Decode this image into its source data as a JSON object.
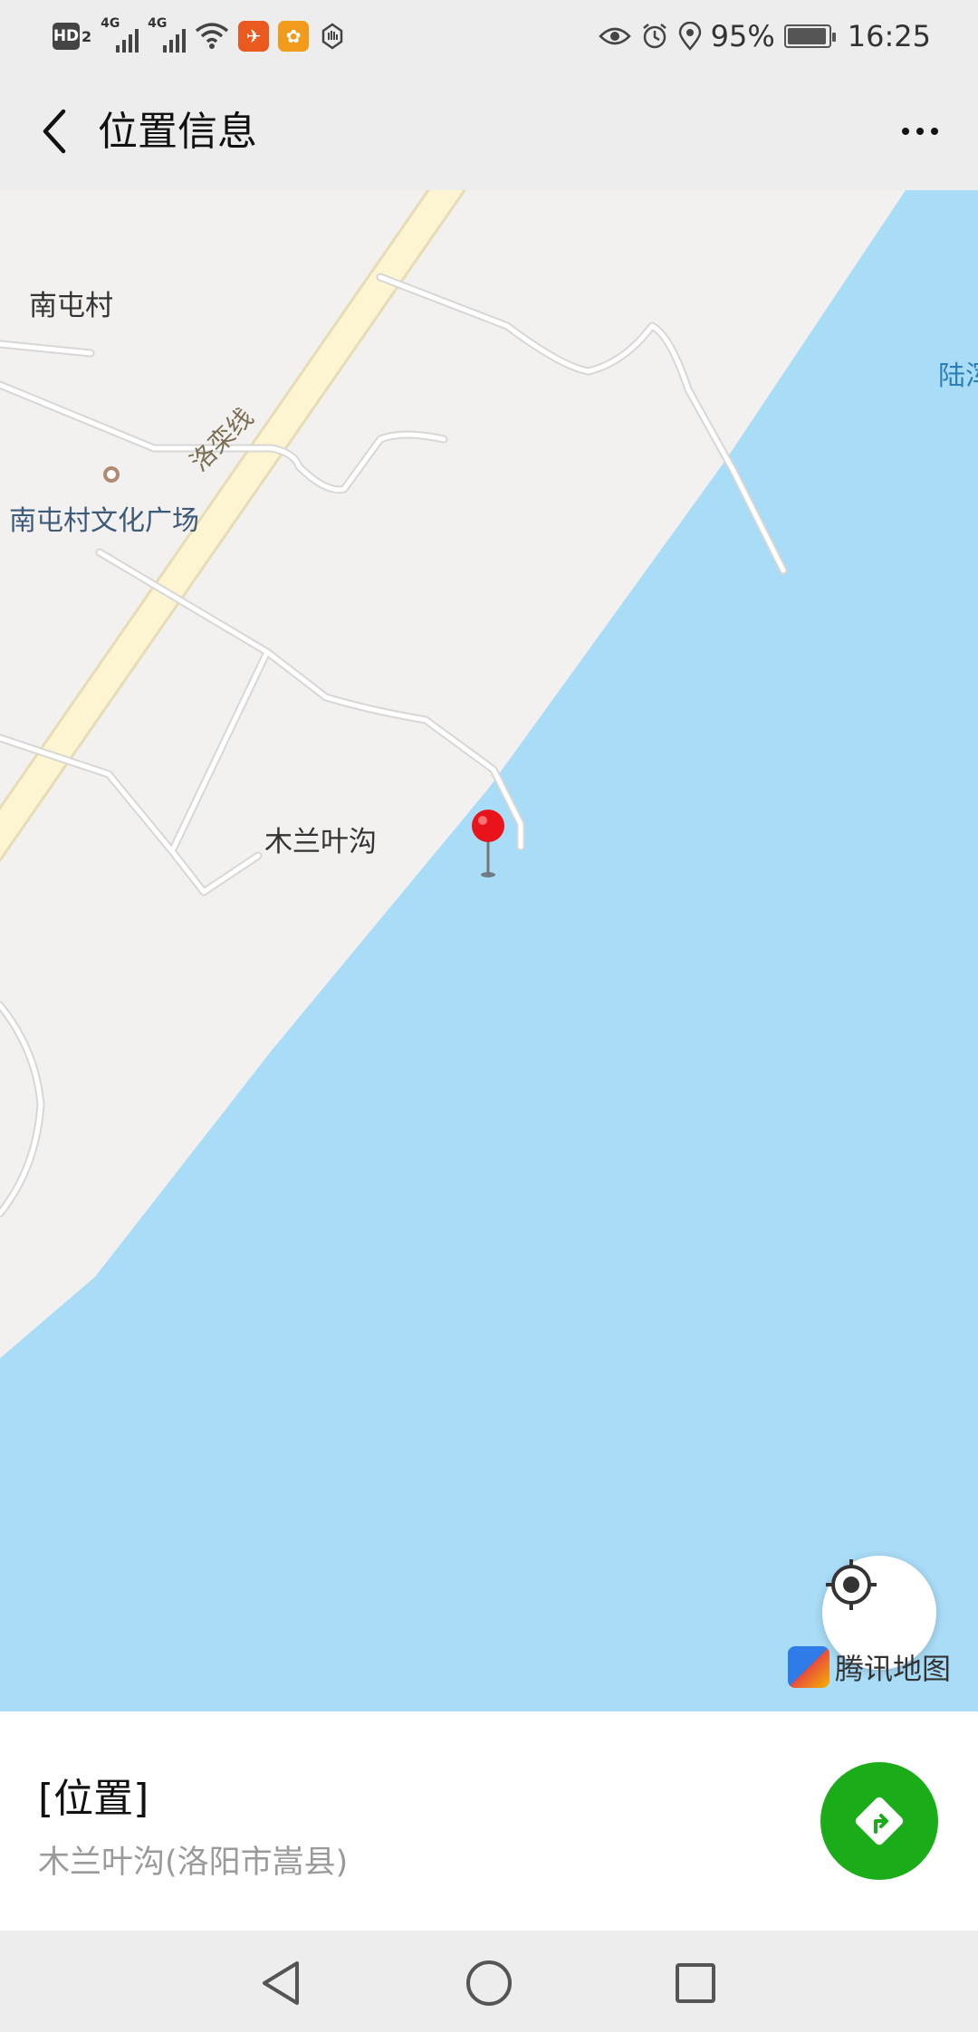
{
  "status_bar": {
    "hd_label": "HD",
    "hd_sub": "2",
    "sim1_label": "4G",
    "sim2_label": "4G",
    "battery_percent": "95%",
    "time": "16:25",
    "icons": [
      "hd-volte-icon",
      "signal-icon",
      "signal-icon",
      "wifi-icon",
      "app-notification-icon",
      "app-notification-icon",
      "hand-icon",
      "eye-comfort-icon",
      "alarm-icon",
      "location-icon",
      "battery-icon"
    ]
  },
  "header": {
    "back_icon": "chevron-left-icon",
    "title": "位置信息",
    "more_icon": "more-icon"
  },
  "map": {
    "labels": {
      "village_1": "南屯村",
      "poi_1": "南屯村文化广场",
      "place_1": "木兰叶沟",
      "road_1": "洛栾线",
      "water_edge": "陆浑"
    },
    "marker_icon": "red-pin-icon",
    "locate_icon": "locate-icon",
    "brand": "腾讯地图",
    "colors": {
      "land": "#f2f1ef",
      "water": "#a9dcf7",
      "road": "#fdf5d2",
      "marker": "#e8131b"
    }
  },
  "info": {
    "title": "[位置]",
    "address": "木兰叶沟(洛阳市嵩县)",
    "navigate_icon": "navigate-icon",
    "accent": "#1aad19"
  },
  "system_nav": {
    "icons": [
      "back-triangle-icon",
      "home-circle-icon",
      "recents-square-icon"
    ]
  }
}
